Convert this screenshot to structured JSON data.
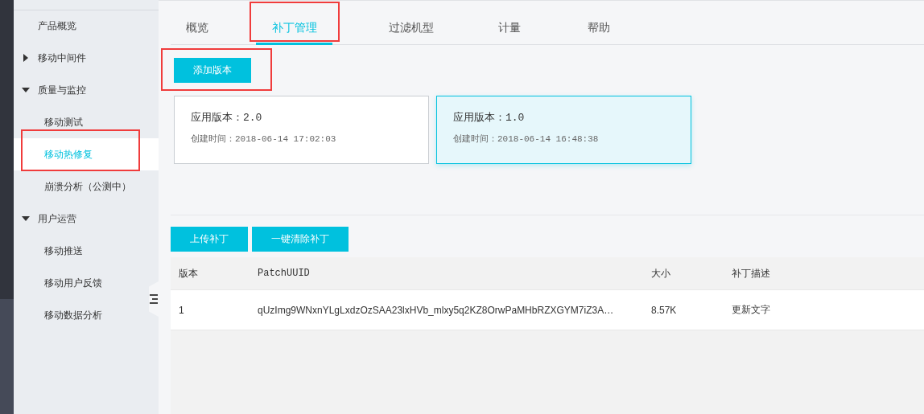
{
  "sidebar": {
    "items": [
      {
        "label": "产品概览",
        "kind": "link",
        "selected": false,
        "highlighted": false
      },
      {
        "label": "移动中间件",
        "kind": "group",
        "expanded": false
      },
      {
        "label": "质量与监控",
        "kind": "group",
        "expanded": true,
        "children": [
          {
            "label": "移动测试",
            "selected": false,
            "highlighted": false
          },
          {
            "label": "移动热修复",
            "selected": true,
            "highlighted": true
          },
          {
            "label": "崩溃分析（公测中）",
            "selected": false,
            "highlighted": false
          }
        ]
      },
      {
        "label": "用户运营",
        "kind": "group",
        "expanded": true,
        "children": [
          {
            "label": "移动推送",
            "selected": false,
            "highlighted": false
          },
          {
            "label": "移动用户反馈",
            "selected": false,
            "highlighted": false
          },
          {
            "label": "移动数据分析",
            "selected": false,
            "highlighted": false
          }
        ]
      }
    ]
  },
  "tabs": [
    {
      "label": "概览",
      "selected": false,
      "highlighted": false
    },
    {
      "label": "补丁管理",
      "selected": true,
      "highlighted": true
    },
    {
      "label": "过滤机型",
      "selected": false,
      "highlighted": false
    },
    {
      "label": "计量",
      "selected": false,
      "highlighted": false
    },
    {
      "label": "帮助",
      "selected": false,
      "highlighted": false
    }
  ],
  "add_button": {
    "label": "添加版本",
    "highlighted": true
  },
  "versions": [
    {
      "title": "应用版本：2.0",
      "created": "创建时间：2018-06-14 17:02:03",
      "selected": false
    },
    {
      "title": "应用版本：1.0",
      "created": "创建时间：2018-06-14 16:48:38",
      "selected": true
    }
  ],
  "actions": [
    "上传补丁",
    "一键清除补丁"
  ],
  "table": {
    "columns": [
      "版本",
      "PatchUUID",
      "大小",
      "补丁描述"
    ],
    "rows": [
      [
        "1",
        "qUzImg9WNxnYLgLxdzOzSAA23lxHVb_mlxy5q2KZ8OrwPaMHbRZXGYM7iZ3A…",
        "8.57K",
        "更新文字"
      ]
    ]
  }
}
